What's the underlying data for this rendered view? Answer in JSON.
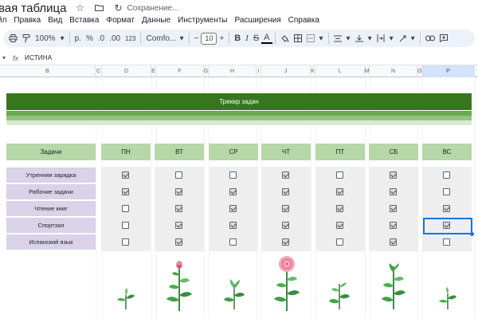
{
  "app": {
    "doc_title": "вая таблица",
    "saving_status": "Сохранение..."
  },
  "menu": [
    "йл",
    "Правка",
    "Вид",
    "Вставка",
    "Формат",
    "Данные",
    "Инструменты",
    "Расширения",
    "Справка"
  ],
  "toolbar": {
    "zoom": "100%",
    "currency": "р.",
    "percent": "%",
    "decrease_decimals": ".0",
    "increase_decimals": ".00",
    "number_format": "123",
    "font": "Comfo...",
    "font_size": "10",
    "bold": "B",
    "italic": "I",
    "strike": "S",
    "text_color": "A"
  },
  "formula_bar": {
    "fx": "fx",
    "value": "ИСТИНА"
  },
  "columns": [
    "B",
    "C",
    "D",
    "E",
    "F",
    "G",
    "H",
    "I",
    "J",
    "K",
    "L",
    "M",
    "N",
    "O",
    "P"
  ],
  "selected_column": "P",
  "tracker": {
    "title": "Трекер задач",
    "tasks_header": "Задачи",
    "days": [
      "ПН",
      "ВТ",
      "СР",
      "ЧТ",
      "ПТ",
      "СБ",
      "ВС"
    ],
    "tasks": [
      {
        "name": "Утренняя зарядка",
        "checks": [
          true,
          false,
          false,
          true,
          false,
          true,
          false
        ]
      },
      {
        "name": "Рабочие задачи",
        "checks": [
          true,
          true,
          true,
          true,
          true,
          true,
          false
        ]
      },
      {
        "name": "Чтение книг",
        "checks": [
          false,
          true,
          true,
          true,
          true,
          true,
          true
        ]
      },
      {
        "name": "Спортзал",
        "checks": [
          false,
          true,
          true,
          true,
          true,
          true,
          true
        ]
      },
      {
        "name": "Испанский язык",
        "checks": [
          false,
          true,
          false,
          true,
          false,
          true,
          false
        ]
      }
    ],
    "selected_cell_value": "ИСТИНА"
  },
  "colors": {
    "banner_green": "#38761d",
    "header_green": "#b6d7a8",
    "task_purple": "#d9d2e9",
    "selection_blue": "#1a73e8",
    "flower_pink": "#e88a9c"
  }
}
